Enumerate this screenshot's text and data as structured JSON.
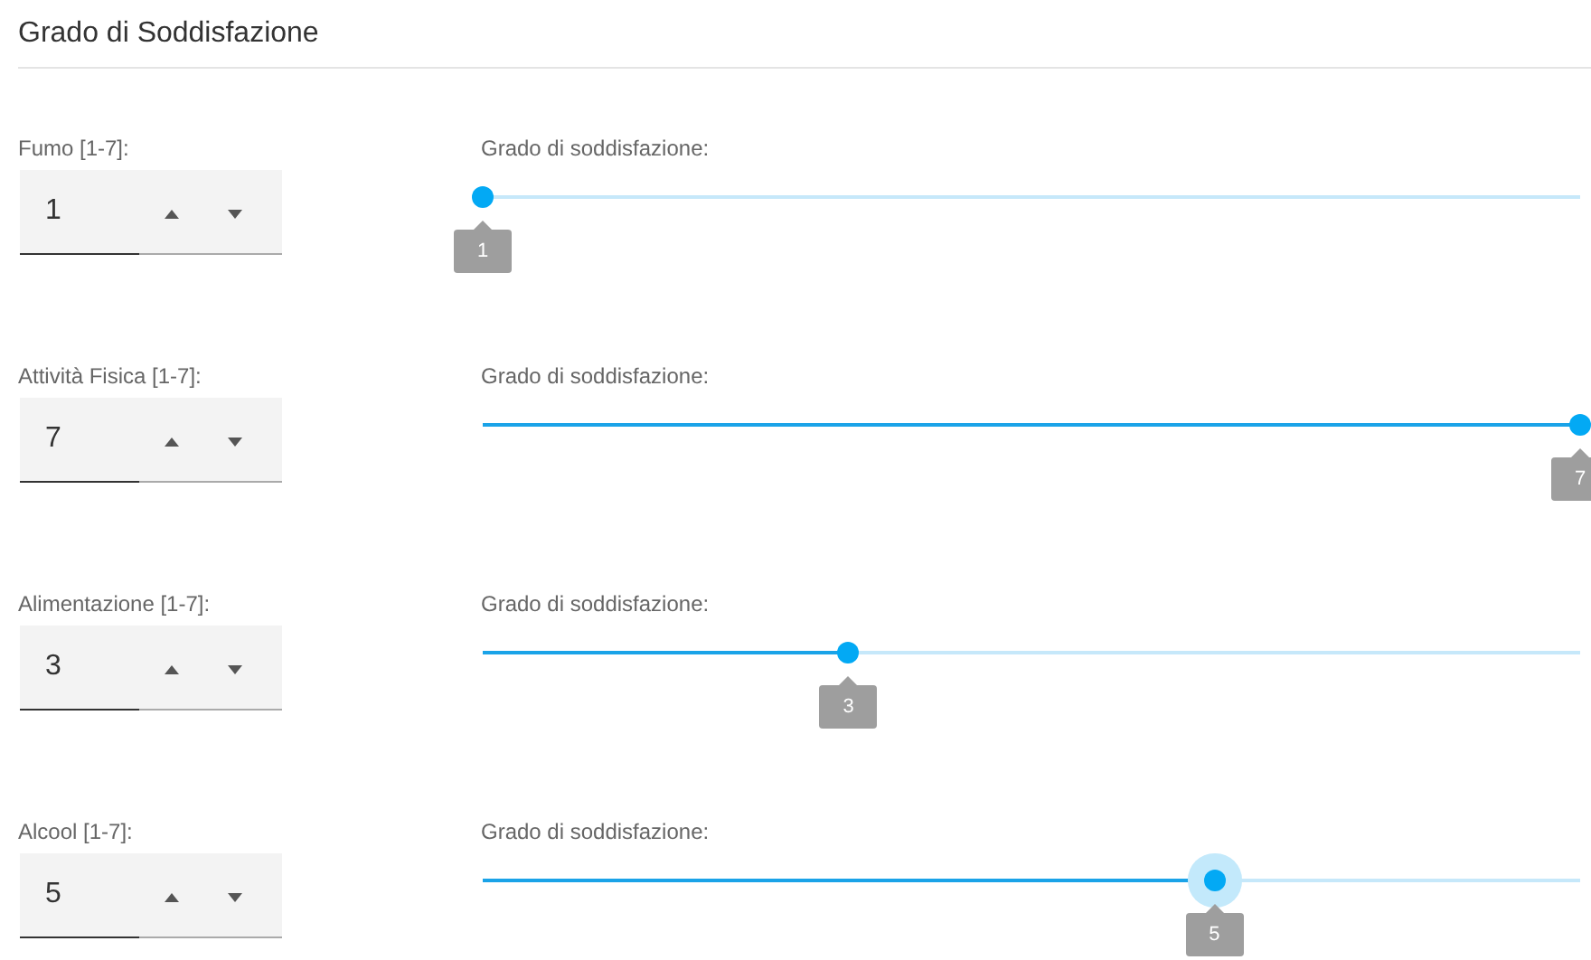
{
  "section_title": "Grado di Soddisfazione",
  "rows": [
    {
      "label": "Fumo [1-7]:",
      "value": "1",
      "slider_label": "Grado di soddisfazione:",
      "level": 0,
      "tooltip": "1",
      "focused": false
    },
    {
      "label": "Attività Fisica [1-7]:",
      "value": "7",
      "slider_label": "Grado di soddisfazione:",
      "level": 1,
      "tooltip": "7",
      "focused": false
    },
    {
      "label": "Alimentazione [1-7]:",
      "value": "3",
      "slider_label": "Grado di soddisfazione:",
      "level": 0.3333,
      "tooltip": "3",
      "focused": false
    },
    {
      "label": "Alcool [1-7]:",
      "value": "5",
      "slider_label": "Grado di soddisfazione:",
      "level": 0.6667,
      "tooltip": "5",
      "focused": true
    }
  ]
}
